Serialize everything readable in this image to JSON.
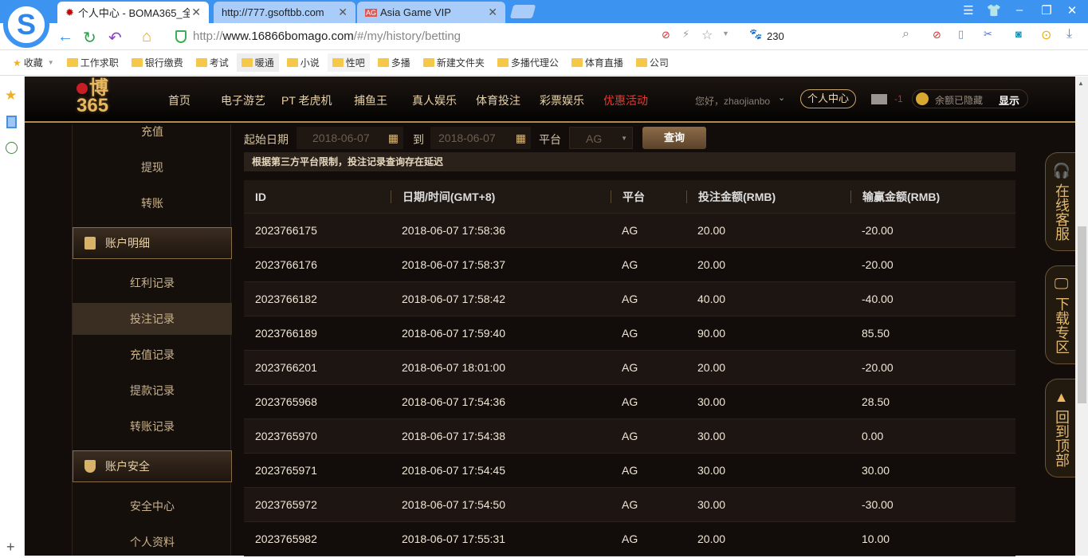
{
  "browser": {
    "tabs": [
      {
        "label": "个人中心 - BOMA365_全",
        "close": "✕"
      },
      {
        "label": "http://777.gsoftbb.com",
        "close": "✕"
      },
      {
        "label": "Asia Game VIP",
        "close": "✕"
      }
    ],
    "url_prefix": "http://",
    "url_host": "www.16866bomago.com",
    "url_path": "/#/my/history/betting",
    "search_value": "230",
    "bookmarks": [
      "收藏",
      "工作求职",
      "银行缴费",
      "考试",
      "暖通",
      "小说",
      "性吧",
      "多播",
      "新建文件夹",
      "多播代理公",
      "体育直播",
      "公司"
    ]
  },
  "site": {
    "logo": "博365",
    "nav": [
      "首页",
      "电子游艺",
      "PT 老虎机",
      "捕鱼王",
      "真人娱乐",
      "体育投注",
      "彩票娱乐",
      "优惠活动"
    ],
    "greeting": "您好，zhaojianbo",
    "center_button": "个人中心",
    "mail_count": "-1",
    "balance": "余额已隐藏",
    "show": "显示"
  },
  "sidebar": {
    "items_top": [
      "充值",
      "提现",
      "转账"
    ],
    "section1": "账户明细",
    "items_mid": [
      "红利记录",
      "投注记录",
      "充值记录",
      "提款记录",
      "转账记录"
    ],
    "section2": "账户安全",
    "items_bot": [
      "安全中心",
      "个人资料"
    ]
  },
  "filter": {
    "start_label": "起始日期",
    "start": "2018-06-07",
    "to": "到",
    "end": "2018-06-07",
    "platform_label": "平台",
    "platform": "AG",
    "query": "查询"
  },
  "notice": "根据第三方平台限制，投注记录查询存在延迟",
  "table": {
    "headers": [
      "ID",
      "日期/时间(GMT+8)",
      "平台",
      "投注金额(RMB)",
      "输赢金额(RMB)"
    ],
    "rows": [
      [
        "2023766175",
        "2018-06-07 17:58:36",
        "AG",
        "20.00",
        "-20.00"
      ],
      [
        "2023766176",
        "2018-06-07 17:58:37",
        "AG",
        "20.00",
        "-20.00"
      ],
      [
        "2023766182",
        "2018-06-07 17:58:42",
        "AG",
        "40.00",
        "-40.00"
      ],
      [
        "2023766189",
        "2018-06-07 17:59:40",
        "AG",
        "90.00",
        "85.50"
      ],
      [
        "2023766201",
        "2018-06-07 18:01:00",
        "AG",
        "20.00",
        "-20.00"
      ],
      [
        "2023765968",
        "2018-06-07 17:54:36",
        "AG",
        "30.00",
        "28.50"
      ],
      [
        "2023765970",
        "2018-06-07 17:54:38",
        "AG",
        "30.00",
        "0.00"
      ],
      [
        "2023765971",
        "2018-06-07 17:54:45",
        "AG",
        "30.00",
        "30.00"
      ],
      [
        "2023765972",
        "2018-06-07 17:54:50",
        "AG",
        "30.00",
        "-30.00"
      ],
      [
        "2023765982",
        "2018-06-07 17:55:31",
        "AG",
        "20.00",
        "10.00"
      ]
    ]
  },
  "floaters": [
    "在线客服",
    "下载专区",
    "回到顶部"
  ]
}
